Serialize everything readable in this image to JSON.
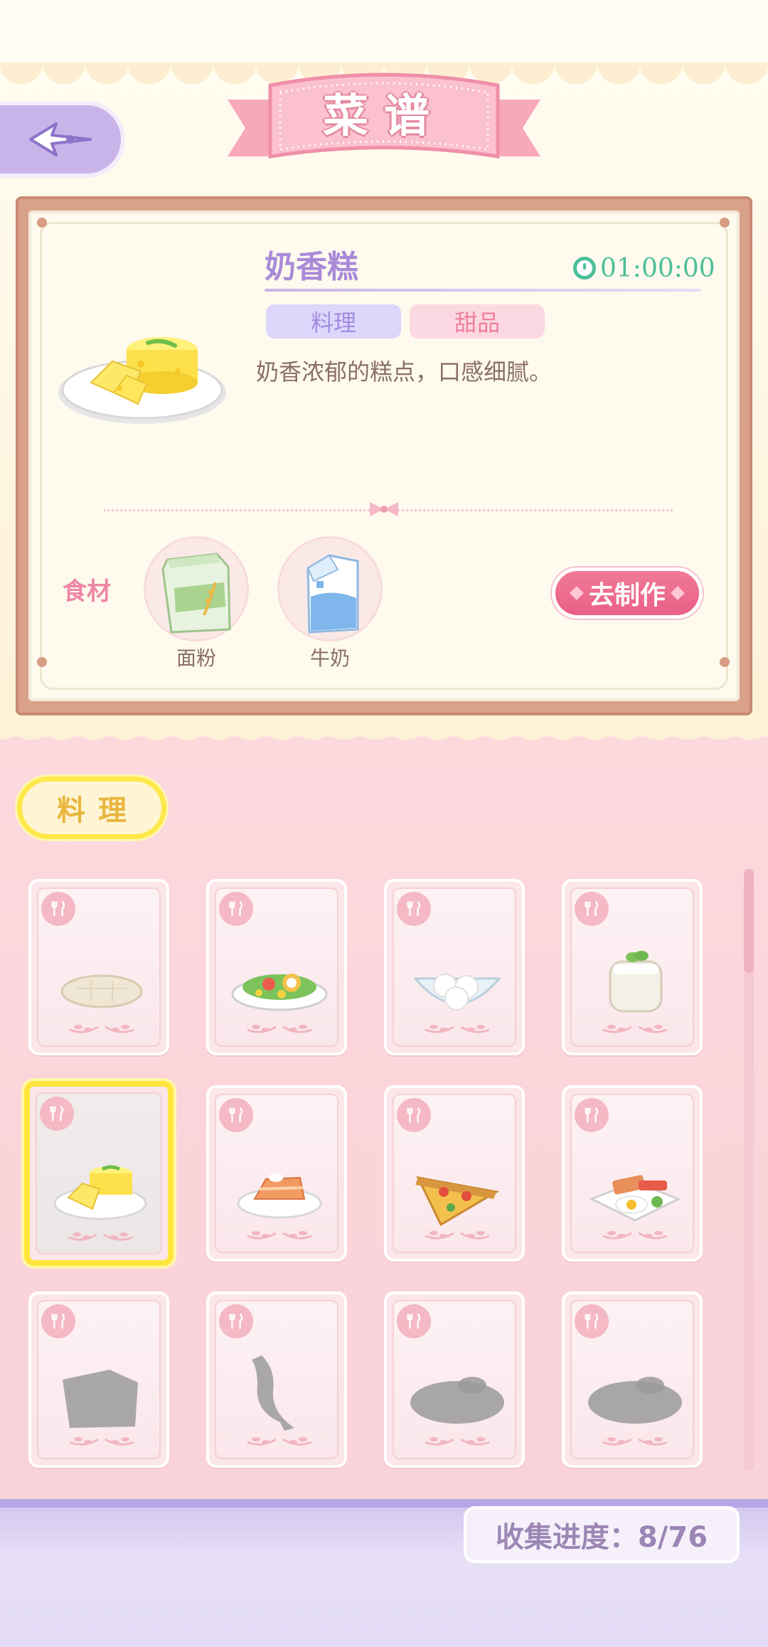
{
  "header": {
    "title": "菜谱",
    "back_icon": "back-arrow-icon"
  },
  "recipe_detail": {
    "name": "奶香糕",
    "timer": "01:00:00",
    "tags": [
      "料理",
      "甜品"
    ],
    "description": "奶香浓郁的糕点，口感细腻。",
    "ingredients_label": "食材",
    "ingredients": [
      {
        "name": "面粉",
        "icon": "flour-bag-icon"
      },
      {
        "name": "牛奶",
        "icon": "milk-carton-icon"
      }
    ],
    "make_button": "去制作"
  },
  "category": {
    "selected": "料理"
  },
  "grid": {
    "items": [
      {
        "icon": "flatbread-icon",
        "unlocked": true,
        "selected": false
      },
      {
        "icon": "salad-icon",
        "unlocked": true,
        "selected": false
      },
      {
        "icon": "rice-balls-bowl-icon",
        "unlocked": true,
        "selected": false
      },
      {
        "icon": "yogurt-jar-icon",
        "unlocked": true,
        "selected": false
      },
      {
        "icon": "milk-cake-icon",
        "unlocked": true,
        "selected": true
      },
      {
        "icon": "salmon-cake-icon",
        "unlocked": true,
        "selected": false
      },
      {
        "icon": "pizza-slice-icon",
        "unlocked": true,
        "selected": false
      },
      {
        "icon": "breakfast-plate-icon",
        "unlocked": true,
        "selected": false
      },
      {
        "icon": "locked-cake-silhouette-icon",
        "unlocked": false,
        "selected": false
      },
      {
        "icon": "locked-fish-silhouette-icon",
        "unlocked": false,
        "selected": false
      },
      {
        "icon": "locked-dish-silhouette-icon",
        "unlocked": false,
        "selected": false
      },
      {
        "icon": "locked-dish-silhouette-icon",
        "unlocked": false,
        "selected": false
      }
    ]
  },
  "progress": {
    "text": "收集进度：8/76",
    "collected": 8,
    "total": 76
  },
  "colors": {
    "accent_purple": "#a98ad8",
    "accent_pink": "#ec87a6",
    "timer_green": "#4dbf9a",
    "highlight_yellow": "#ffe53b"
  }
}
